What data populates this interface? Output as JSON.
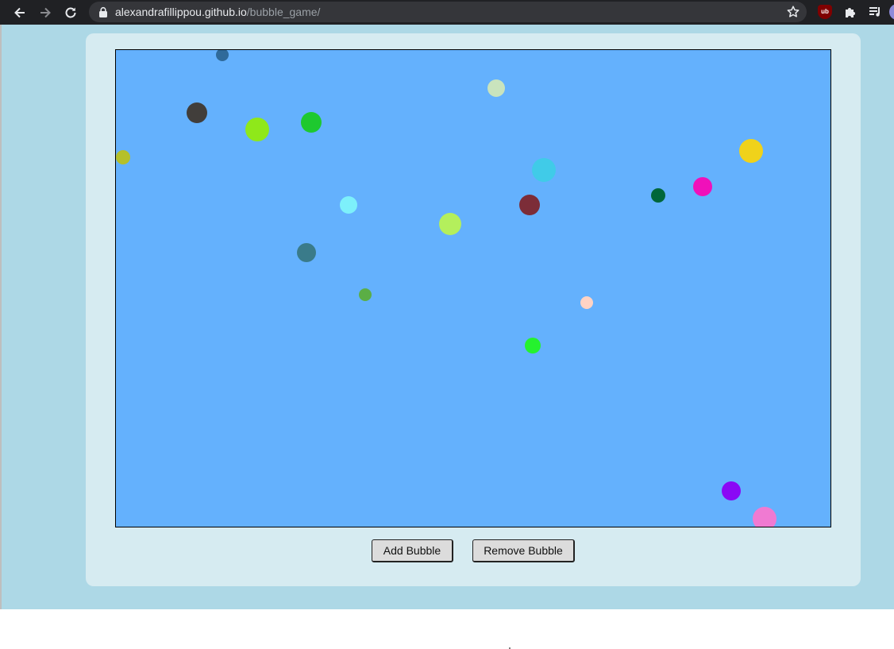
{
  "browser": {
    "url_host": "alexandrafillippou.github.io",
    "url_path": "/bubble_game/",
    "icons": {
      "back": "arrow-left-icon",
      "forward": "arrow-right-icon",
      "reload": "reload-icon",
      "lock": "lock-icon",
      "bookmark": "star-icon",
      "extension_1": "ublock-icon",
      "extension_1_text": "ub",
      "extensions": "puzzle-icon",
      "media": "media-queue-icon"
    }
  },
  "page": {
    "background_color": "#add8e6",
    "card_color": "#d6ebf1",
    "board_color": "#64b1fd",
    "bubbles": [
      {
        "color": "#2f6a9a"
      },
      {
        "color": "#c9e4bd"
      },
      {
        "color": "#413e3b"
      },
      {
        "color": "#8fe81a"
      },
      {
        "color": "#1ec92f"
      },
      {
        "color": "#b5c02a"
      },
      {
        "color": "#f0d21a"
      },
      {
        "color": "#40cbe8"
      },
      {
        "color": "#00663a"
      },
      {
        "color": "#f010ba"
      },
      {
        "color": "#7df0fb"
      },
      {
        "color": "#b4ef5c"
      },
      {
        "color": "#7c2d38"
      },
      {
        "color": "#3a7b8a"
      },
      {
        "color": "#5bae45"
      },
      {
        "color": "#ffd3c4"
      },
      {
        "color": "#25f22e"
      },
      {
        "color": "#8a09f5"
      },
      {
        "color": "#f07ad2"
      }
    ],
    "buttons": {
      "add": "Add Bubble",
      "remove": "Remove Bubble"
    }
  }
}
